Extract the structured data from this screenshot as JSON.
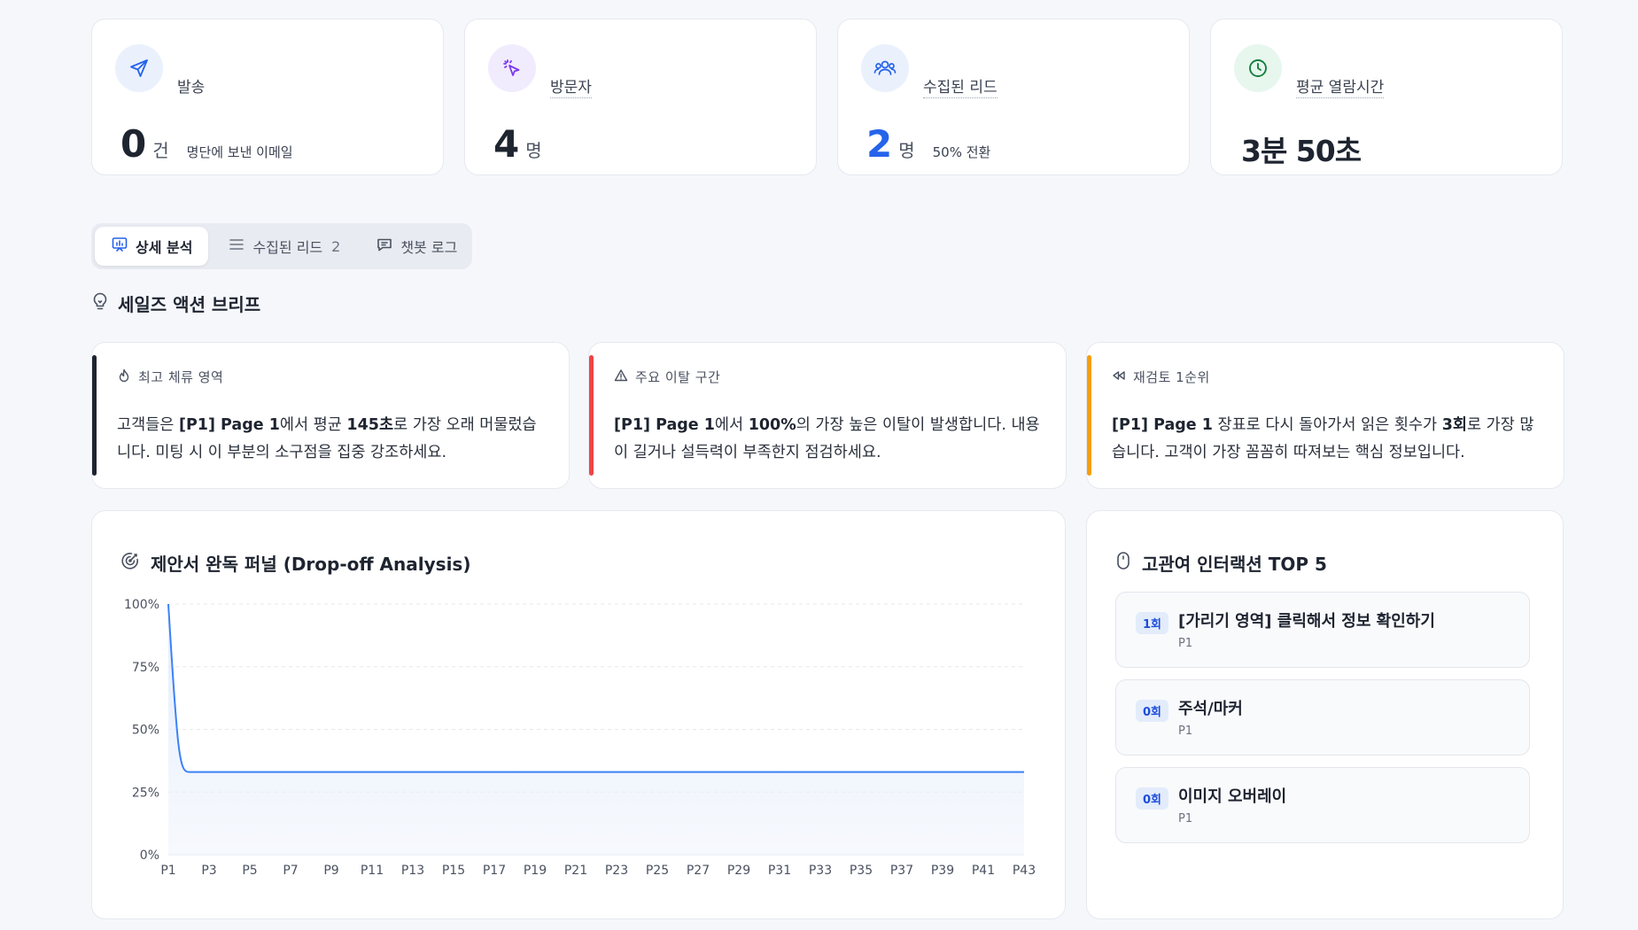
{
  "stats": [
    {
      "label": "발송",
      "value": "0",
      "unit": "건",
      "sub": "명단에 보낸 이메일",
      "icon": "send-icon",
      "icon_bg": "#eaf1fd",
      "icon_color": "#2563eb"
    },
    {
      "label": "방문자",
      "value": "4",
      "unit": "명",
      "sub": "",
      "icon": "pointer-click-icon",
      "icon_bg": "#f1ecfd",
      "icon_color": "#7c3aed"
    },
    {
      "label": "수집된 리드",
      "value": "2",
      "unit": "명",
      "sub": "50% 전환",
      "icon": "users-icon",
      "icon_bg": "#eaf1fd",
      "icon_color": "#2563eb"
    },
    {
      "label": "평균 열람시간",
      "value": "3분 50초",
      "unit": "",
      "sub": "",
      "icon": "clock-icon",
      "icon_bg": "#e7f7ee",
      "icon_color": "#16a34a"
    }
  ],
  "tabs": [
    {
      "label": "상세 분석",
      "count": "",
      "icon": "presentation-chart-icon",
      "active": true
    },
    {
      "label": "수집된 리드",
      "count": "2",
      "icon": "list-icon",
      "active": false
    },
    {
      "label": "챗봇 로그",
      "count": "",
      "icon": "chat-icon",
      "active": false
    }
  ],
  "section": {
    "title": "세일즈 액션 브리프",
    "icon": "lightbulb-icon"
  },
  "briefs": [
    {
      "head": "최고 체류 영역",
      "icon": "flame-icon",
      "accent": "#1e2430",
      "parts": [
        {
          "t": "고객들은 ",
          "b": false
        },
        {
          "t": "[P1] Page 1",
          "b": true
        },
        {
          "t": "에서 평균 ",
          "b": false
        },
        {
          "t": "145초",
          "b": true
        },
        {
          "t": "로 가장 오래 머물렀습니다. 미팅 시 이 부분의 소구점을 집중 강조하세요.",
          "b": false
        }
      ]
    },
    {
      "head": "주요 이탈 구간",
      "icon": "warning-icon",
      "accent": "#ef4444",
      "parts": [
        {
          "t": "[P1] Page 1",
          "b": true
        },
        {
          "t": "에서 ",
          "b": false
        },
        {
          "t": "100%",
          "b": true
        },
        {
          "t": "의 가장 높은 이탈이 발생합니다. 내용이 길거나 설득력이 부족한지 점검하세요.",
          "b": false
        }
      ]
    },
    {
      "head": "재검토 1순위",
      "icon": "rewind-icon",
      "accent": "#f59e0b",
      "parts": [
        {
          "t": "[P1] Page 1",
          "b": true
        },
        {
          "t": " 장표로 다시 돌아가서 읽은 횟수가 ",
          "b": false
        },
        {
          "t": "3회",
          "b": true
        },
        {
          "t": "로 가장 많습니다. 고객이 가장 꼼꼼히 따져보는 핵심 정보입니다.",
          "b": false
        }
      ]
    }
  ],
  "funnel": {
    "title": "제안서 완독 퍼널 (Drop-off Analysis)",
    "icon": "target-icon",
    "line_color": "#3b82f6"
  },
  "chart_data": {
    "type": "area",
    "title": "제안서 완독 퍼널 (Drop-off Analysis)",
    "xlabel": "",
    "ylabel": "",
    "x": [
      "P1",
      "P2",
      "P3",
      "P4",
      "P5",
      "P6",
      "P7",
      "P8",
      "P9",
      "P10",
      "P11",
      "P12",
      "P13",
      "P14",
      "P15",
      "P16",
      "P17",
      "P18",
      "P19",
      "P20",
      "P21",
      "P22",
      "P23",
      "P24",
      "P25",
      "P26",
      "P27",
      "P28",
      "P29",
      "P30",
      "P31",
      "P32",
      "P33",
      "P34",
      "P35",
      "P36",
      "P37",
      "P38",
      "P39",
      "P40",
      "P41",
      "P42",
      "P43"
    ],
    "tick_labels": [
      "P1",
      "P3",
      "P5",
      "P7",
      "P9",
      "P11",
      "P13",
      "P15",
      "P17",
      "P19",
      "P21",
      "P23",
      "P25",
      "P27",
      "P29",
      "P31",
      "P33",
      "P35",
      "P37",
      "P39",
      "P41",
      "P43"
    ],
    "y_ticks": [
      "0%",
      "25%",
      "50%",
      "75%",
      "100%"
    ],
    "values": [
      100,
      33,
      33,
      33,
      33,
      33,
      33,
      33,
      33,
      33,
      33,
      33,
      33,
      33,
      33,
      33,
      33,
      33,
      33,
      33,
      33,
      33,
      33,
      33,
      33,
      33,
      33,
      33,
      33,
      33,
      33,
      33,
      33,
      33,
      33,
      33,
      33,
      33,
      33,
      33,
      33,
      33,
      33
    ],
    "ylim": [
      0,
      100
    ],
    "grid": true
  },
  "interactions": {
    "title": "고관여 인터랙션 TOP 5",
    "icon": "mouse-icon",
    "items": [
      {
        "badge": "1회",
        "title": "[가리기 영역] 클릭해서 정보 확인하기",
        "page": "P1"
      },
      {
        "badge": "0회",
        "title": "주석/마커",
        "page": "P1"
      },
      {
        "badge": "0회",
        "title": "이미지 오버레이",
        "page": "P1"
      }
    ]
  }
}
